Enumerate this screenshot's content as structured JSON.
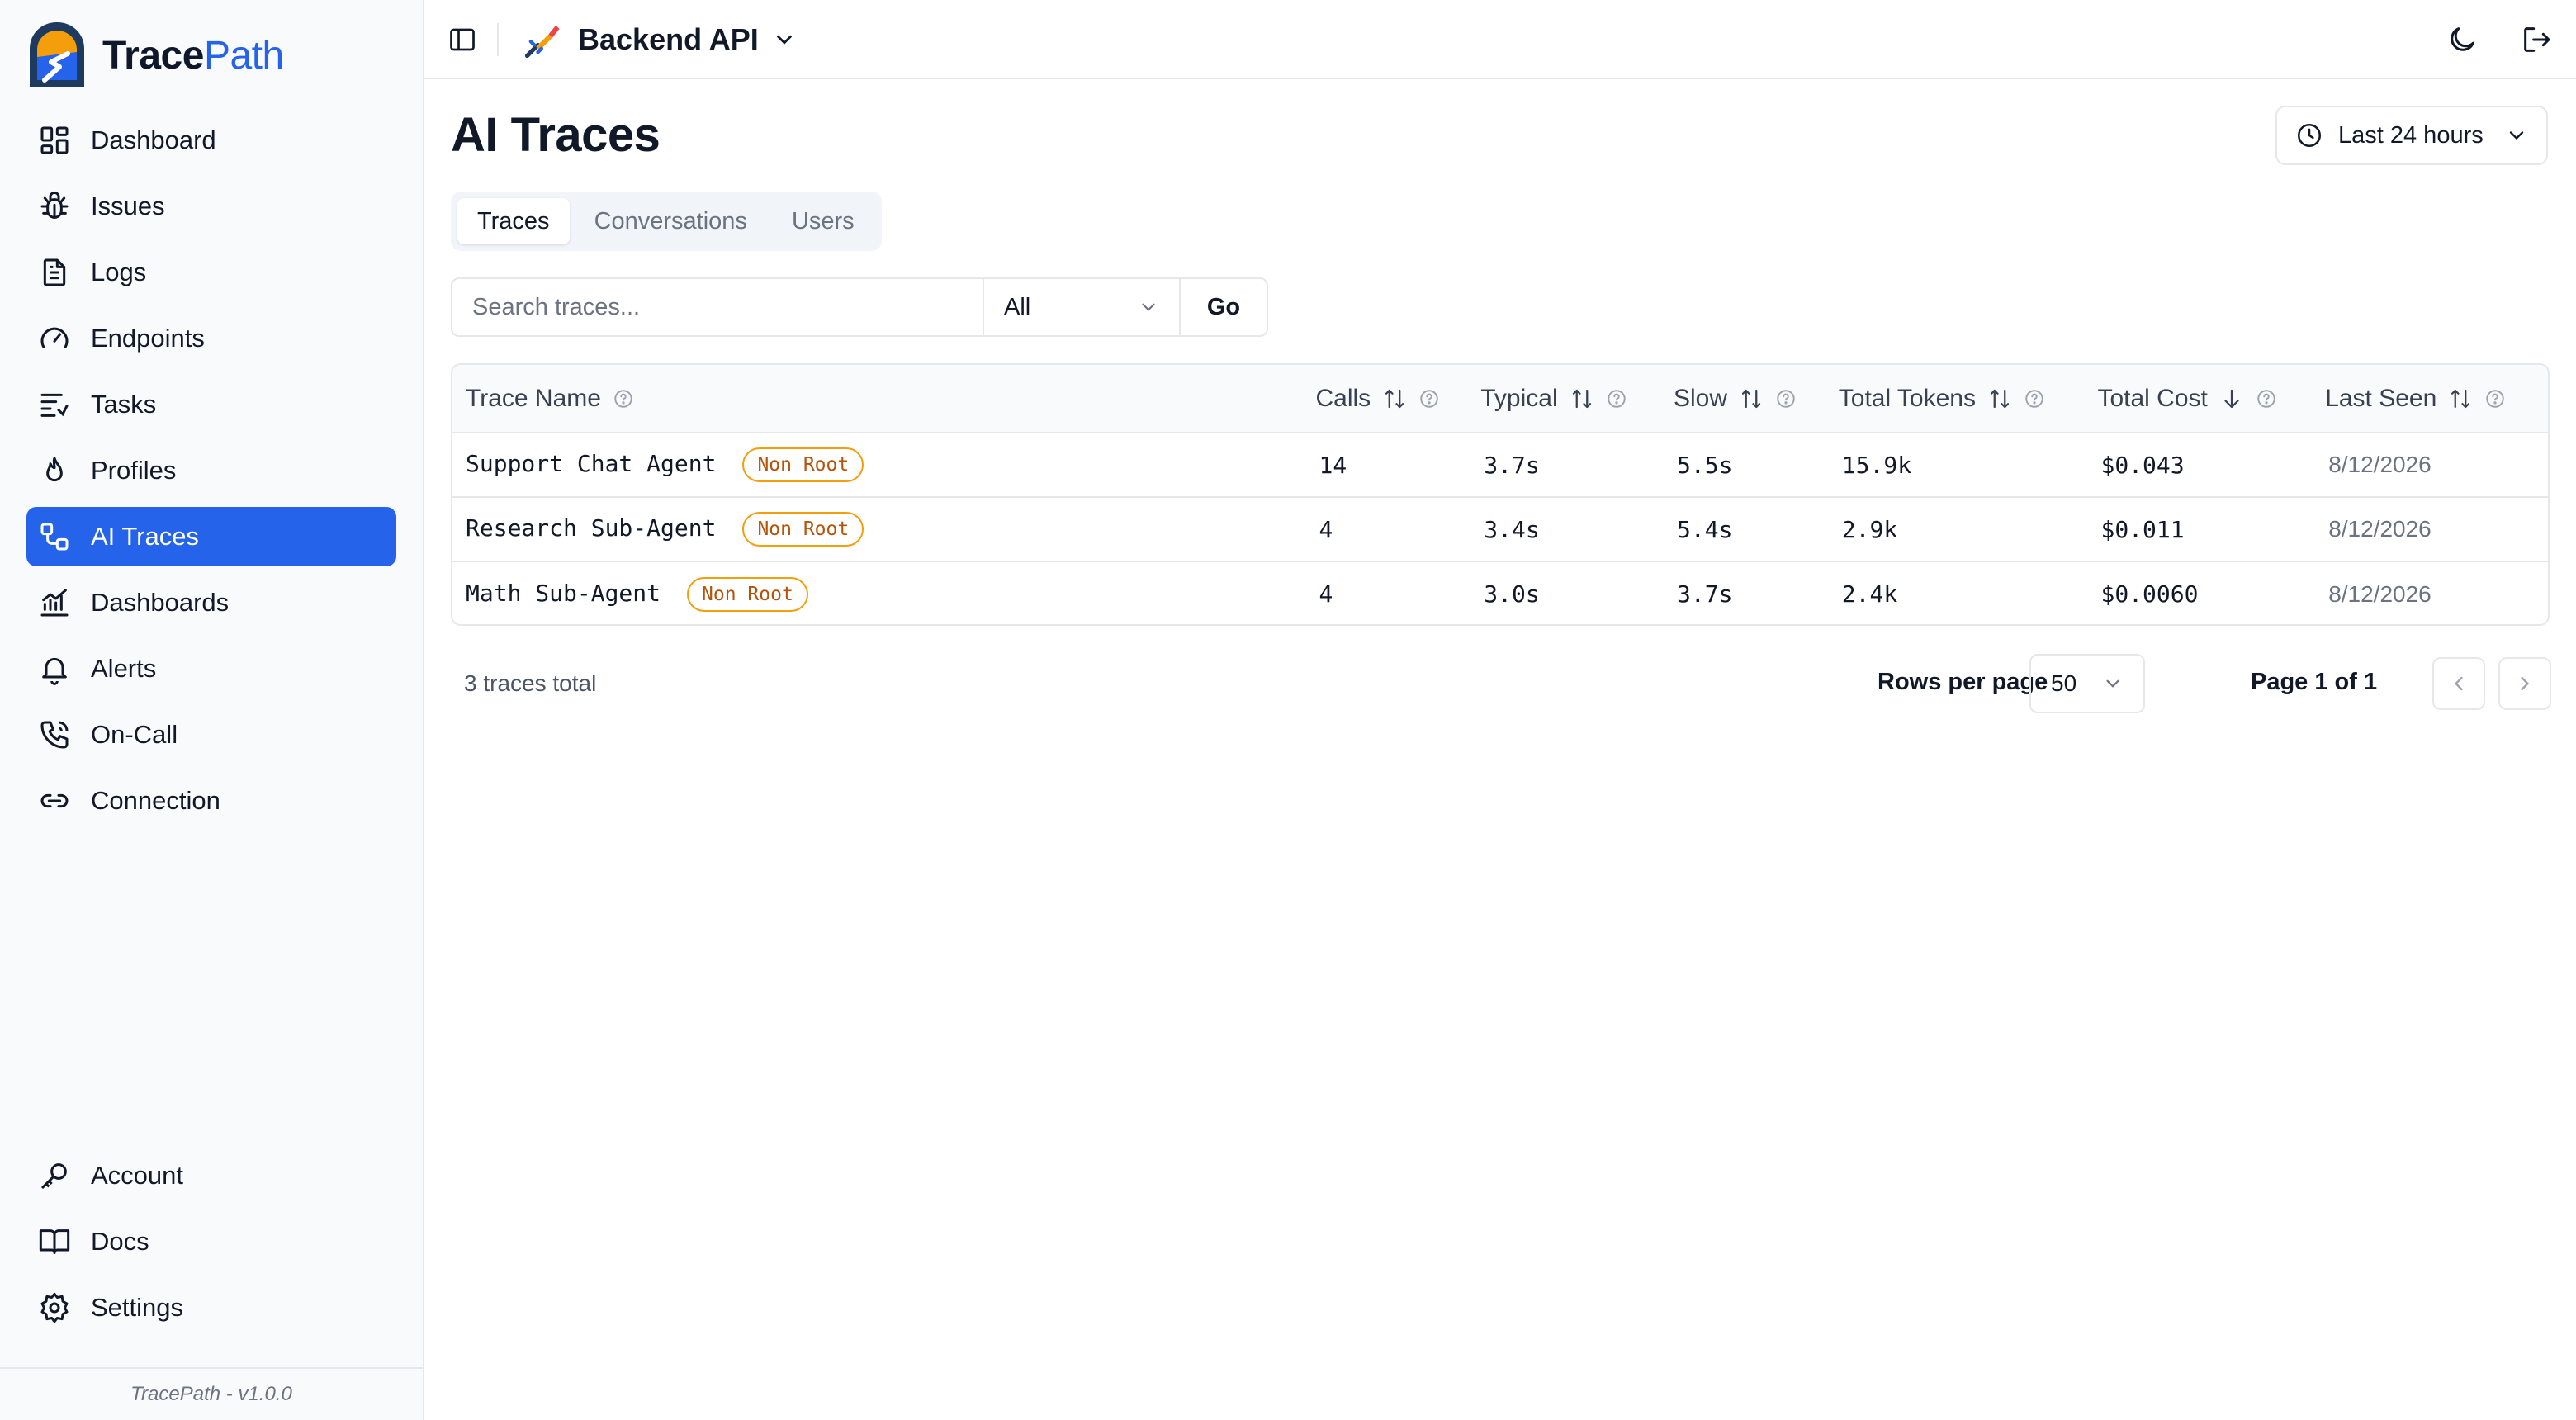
{
  "brand": {
    "name_part1": "Trace",
    "name_part2": "Path",
    "version": "TracePath - v1.0.0"
  },
  "sidebar": {
    "items": [
      {
        "label": "Dashboard",
        "icon": "grid-icon"
      },
      {
        "label": "Issues",
        "icon": "bug-icon"
      },
      {
        "label": "Logs",
        "icon": "file-text-icon"
      },
      {
        "label": "Endpoints",
        "icon": "gauge-icon"
      },
      {
        "label": "Tasks",
        "icon": "list-todo-icon"
      },
      {
        "label": "Profiles",
        "icon": "flame-icon"
      },
      {
        "label": "AI Traces",
        "icon": "workflow-icon",
        "active": true
      },
      {
        "label": "Dashboards",
        "icon": "chart-line-icon"
      },
      {
        "label": "Alerts",
        "icon": "bell-icon"
      },
      {
        "label": "On-Call",
        "icon": "phone-icon"
      },
      {
        "label": "Connection",
        "icon": "link-icon"
      }
    ],
    "bottom_items": [
      {
        "label": "Account",
        "icon": "key-icon"
      },
      {
        "label": "Docs",
        "icon": "book-icon"
      },
      {
        "label": "Settings",
        "icon": "gear-icon"
      }
    ]
  },
  "topbar": {
    "project_name": "Backend API"
  },
  "page": {
    "title": "AI Traces",
    "time_range": "Last 24 hours",
    "tabs": [
      "Traces",
      "Conversations",
      "Users"
    ],
    "active_tab": "Traces",
    "search_placeholder": "Search traces...",
    "filter_value": "All",
    "go_label": "Go"
  },
  "table": {
    "columns": [
      "Trace Name",
      "Calls",
      "Typical",
      "Slow",
      "Total Tokens",
      "Total Cost",
      "Last Seen"
    ],
    "rows": [
      {
        "name": "Support Chat Agent",
        "badge": "Non Root",
        "calls": "14",
        "typical": "3.7s",
        "slow": "5.5s",
        "tokens": "15.9k",
        "cost": "$0.043",
        "last_seen": "8/12/2026"
      },
      {
        "name": "Research Sub-Agent",
        "badge": "Non Root",
        "calls": "4",
        "typical": "3.4s",
        "slow": "5.4s",
        "tokens": "2.9k",
        "cost": "$0.011",
        "last_seen": "8/12/2026"
      },
      {
        "name": "Math Sub-Agent",
        "badge": "Non Root",
        "calls": "4",
        "typical": "3.0s",
        "slow": "3.7s",
        "tokens": "2.4k",
        "cost": "$0.0060",
        "last_seen": "8/12/2026"
      }
    ]
  },
  "footer": {
    "total_text": "3 traces total",
    "rows_per_page_label": "Rows per page",
    "rows_per_page": "50",
    "page_label": "Page 1 of 1"
  },
  "colors": {
    "accent": "#2563eb",
    "badge_border": "#f59e0b",
    "badge_text": "#b45309"
  }
}
